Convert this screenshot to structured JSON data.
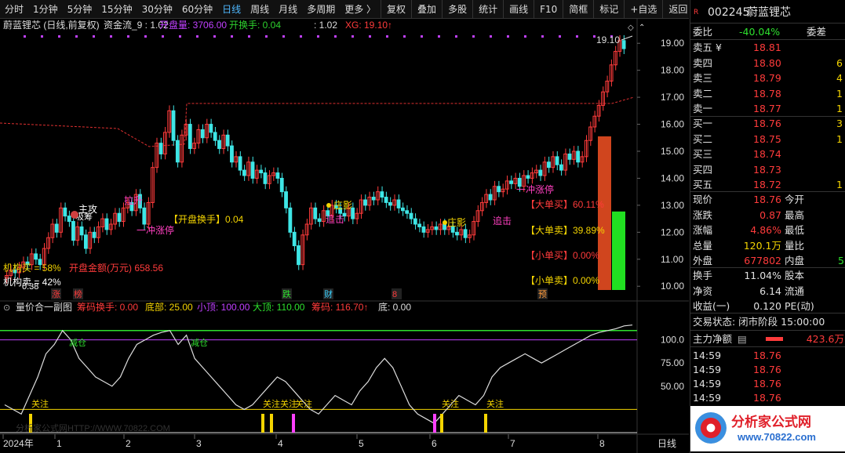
{
  "toolbar": {
    "periods": [
      "分时",
      "1分钟",
      "5分钟",
      "15分钟",
      "30分钟",
      "60分钟",
      "日线",
      "周线",
      "月线",
      "多周期",
      "更多 〉"
    ],
    "active_period": "日线",
    "actions": [
      "复权",
      "叠加",
      "多股",
      "统计",
      "画线",
      "F10",
      "简框",
      "标记",
      "+自选",
      "返回"
    ]
  },
  "header": {
    "stock_line": "蔚蓝锂芯 (日线,前复权)",
    "indicator": "资金流_9 : 1.02",
    "open_vol_label": "开盘量: 3706.00",
    "open_turnover_label": "开换手: 0.04",
    "value2": ": 1.02",
    "xg_label": "XG: 19.10↑"
  },
  "main": {
    "price_labels": [
      "19.00",
      "18.00",
      "17.00",
      "16.00",
      "15.00",
      "14.00",
      "13.00",
      "12.00",
      "11.00",
      "10.00"
    ],
    "top_marker": "19.10",
    "annotations": {
      "zhugong": "主攻",
      "xisheng": "吸筹",
      "lasheng": "拉升",
      "chongzhang": "一冲涨停",
      "kaipan": "【开盘换手】0.04",
      "zhuangying1": "庄影",
      "zhuiji1": "追击",
      "zhuangying2": "庄影",
      "zhuiji2": "追击",
      "chongzhang2": "一冲涨停",
      "jigou": "机构买 = 58%",
      "kaipan_amt": "开盘金额(万元) 658.56",
      "jigoumai2": "机构卖 = 42%",
      "val_0.38": "0.38"
    },
    "order_panel": {
      "big_buy": "【大单买】60.11%",
      "big_sell": "【大单卖】39.89%",
      "small_buy": "【小单买】0.00%",
      "small_sell": "【小单卖】0.00%",
      "big_buy_frac": 0.6011,
      "big_sell_frac": 0.3989
    },
    "bottom_tags": [
      "涨",
      "榜",
      "跌",
      "财",
      "8",
      "预"
    ]
  },
  "sub": {
    "title": "量价合一副图",
    "labels": {
      "chip_turn": "筹码换手: 0.00",
      "bottom": "底部: 25.00",
      "small_top": "小顶: 100.00",
      "big_top": "大顶: 110.00",
      "chip": "筹码: 116.70↑",
      "di": "底: 0.00"
    },
    "y_labels": [
      "100.0",
      "75.00",
      "50.00"
    ],
    "notes": [
      "减仓",
      "减仓",
      "关注",
      "关注关注",
      "关注",
      "关注",
      "关注"
    ],
    "watermark": "分析家公式网HTTP://WWW.70822.COM"
  },
  "x_axis": {
    "labels": [
      "2024年",
      "1",
      "2",
      "3",
      "4",
      "5",
      "6",
      "7",
      "8"
    ],
    "right_label": "日线"
  },
  "quote": {
    "title_code": "002245",
    "title_name": "蔚蓝锂芯",
    "badge": "R",
    "weibi_label": "委比",
    "weibi": "-40.04%",
    "weicha_label": "委差",
    "asks": [
      {
        "label": "卖五 ¥",
        "price": "18.81",
        "vol": ""
      },
      {
        "label": "卖四",
        "price": "18.80",
        "vol": "6"
      },
      {
        "label": "卖三",
        "price": "18.79",
        "vol": "4"
      },
      {
        "label": "卖二",
        "price": "18.78",
        "vol": "1"
      },
      {
        "label": "卖一",
        "price": "18.77",
        "vol": "1"
      }
    ],
    "bids": [
      {
        "label": "买一",
        "price": "18.76",
        "vol": "3"
      },
      {
        "label": "买二",
        "price": "18.75",
        "vol": "1"
      },
      {
        "label": "买三",
        "price": "18.74",
        "vol": ""
      },
      {
        "label": "买四",
        "price": "18.73",
        "vol": ""
      },
      {
        "label": "买五",
        "price": "18.72",
        "vol": "1"
      }
    ],
    "stats": [
      {
        "l": "现价",
        "v": "18.76",
        "r": "今开",
        "c": "red"
      },
      {
        "l": "涨跌",
        "v": "0.87",
        "r": "最高",
        "c": "red"
      },
      {
        "l": "涨幅",
        "v": "4.86%",
        "r": "最低",
        "c": "red"
      },
      {
        "l": "总量",
        "v": "120.1万",
        "r": "量比",
        "c": "yel"
      },
      {
        "l": "外盘",
        "v": "677802",
        "r": "内盘",
        "c": "red"
      }
    ],
    "stats2": [
      {
        "l": "换手",
        "v": "11.04%",
        "r": "股本",
        "c": "wht"
      },
      {
        "l": "净资",
        "v": "6.14",
        "r": "流通",
        "c": "wht"
      },
      {
        "l": "收益(一)",
        "v": "0.120",
        "r": "PE(动)",
        "c": "wht"
      }
    ],
    "trade_status": "交易状态: 闭市阶段 15:00:00",
    "main_net_label": "主力净额",
    "main_net": "423.6万",
    "ticks": [
      {
        "t": "14:59",
        "p": "18.76"
      },
      {
        "t": "14:59",
        "p": "18.76"
      },
      {
        "t": "14:59",
        "p": "18.76"
      },
      {
        "t": "14:59",
        "p": "18.76"
      }
    ],
    "logo_text": "分析家公式网",
    "logo_url": "www.70822.com"
  },
  "chart_data": {
    "type": "candlestick",
    "ylim": [
      9.6,
      19.5
    ],
    "x_labels": [
      "2024年",
      "1",
      "2",
      "3",
      "4",
      "5",
      "6",
      "7",
      "8"
    ],
    "closes": [
      10.4,
      10.6,
      10.5,
      10.7,
      10.9,
      10.8,
      11.2,
      11.0,
      10.8,
      11.4,
      11.8,
      12.3,
      12.0,
      12.9,
      12.6,
      12.4,
      11.7,
      12.2,
      11.9,
      11.4,
      12.0,
      11.8,
      12.2,
      12.5,
      12.1,
      12.3,
      12.7,
      12.4,
      12.9,
      13.1,
      12.8,
      13.4,
      12.9,
      12.3,
      13.1,
      14.4,
      15.3,
      14.9,
      15.7,
      16.5,
      15.4,
      14.6,
      15.6,
      16.0,
      15.1,
      15.3,
      15.8,
      15.5,
      16.0,
      15.7,
      15.4,
      15.1,
      15.6,
      15.2,
      14.6,
      14.8,
      14.3,
      14.1,
      14.6,
      14.0,
      14.3,
      14.2,
      13.8,
      14.1,
      14.2,
      14.0,
      13.5,
      12.9,
      12.0,
      11.5,
      10.8,
      11.9,
      12.3,
      12.9,
      12.5,
      12.4,
      12.8,
      12.6,
      13.0,
      12.9,
      12.7,
      12.6,
      12.9,
      12.5,
      12.7,
      13.2,
      13.0,
      13.3,
      13.2,
      13.5,
      13.3,
      13.1,
      13.0,
      13.2,
      12.9,
      12.8,
      12.7,
      12.5,
      12.3,
      12.2,
      12.0,
      12.1,
      12.2,
      12.1,
      12.3,
      12.1,
      12.2,
      12.0,
      11.9,
      12.1,
      11.8,
      11.9,
      12.4,
      12.8,
      13.1,
      13.4,
      13.2,
      13.7,
      13.5,
      13.6,
      13.9,
      13.8,
      14.0,
      13.7,
      14.1,
      14.0,
      14.2,
      14.3,
      14.1,
      14.6,
      14.4,
      14.8,
      14.5,
      14.3,
      14.9,
      14.7,
      15.0,
      14.6,
      14.8,
      15.4,
      15.9,
      16.3,
      16.7,
      17.2,
      17.6,
      18.2,
      18.7,
      19.1,
      18.8
    ],
    "sub_line": [
      30,
      25,
      20,
      40,
      60,
      85,
      95,
      110,
      100,
      80,
      70,
      60,
      55,
      50,
      60,
      80,
      95,
      100,
      105,
      108,
      110,
      95,
      105,
      80,
      70,
      60,
      50,
      40,
      30,
      25,
      30,
      40,
      50,
      60,
      55,
      45,
      35,
      25,
      20,
      30,
      40,
      35,
      30,
      45,
      55,
      70,
      80,
      70,
      50,
      30,
      20,
      15,
      10,
      20,
      30,
      40,
      35,
      30,
      40,
      60,
      70,
      75,
      80,
      85,
      80,
      75,
      80,
      85,
      90,
      95,
      100,
      105,
      108,
      110,
      112,
      115,
      116
    ]
  }
}
